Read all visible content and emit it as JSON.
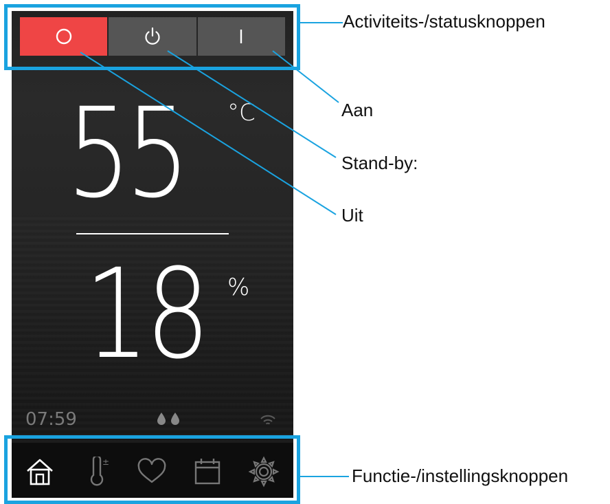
{
  "status_buttons": [
    {
      "id": "off",
      "label": "Uit",
      "icon": "circle-icon",
      "active": true
    },
    {
      "id": "standby",
      "label": "Stand-by:",
      "icon": "power-icon",
      "active": false
    },
    {
      "id": "on",
      "label": "Aan",
      "icon": "bar-icon",
      "active": false
    }
  ],
  "readouts": {
    "temperature": {
      "value": "55",
      "unit": "°C"
    },
    "humidity": {
      "value": "18",
      "unit": "%"
    }
  },
  "info": {
    "time": "07:59",
    "humidity_icon": "water-drops-icon",
    "signal_icon": "wifi-icon"
  },
  "nav": [
    {
      "name": "home",
      "icon": "home-icon"
    },
    {
      "name": "temperature-adjust",
      "icon": "thermometer-icon"
    },
    {
      "name": "favorites",
      "icon": "heart-icon"
    },
    {
      "name": "schedule",
      "icon": "calendar-icon"
    },
    {
      "name": "settings",
      "icon": "gear-icon"
    }
  ],
  "annotations": {
    "status_group": "Activiteits-/statusknoppen",
    "on": "Aan",
    "standby": "Stand-by:",
    "off": "Uit",
    "function_group": "Functie-/instellingsknoppen"
  },
  "colors": {
    "active_red": "#ef4545",
    "button_gray": "#555555",
    "highlight_blue": "#1aa3e0",
    "icon_gray": "#777777"
  }
}
